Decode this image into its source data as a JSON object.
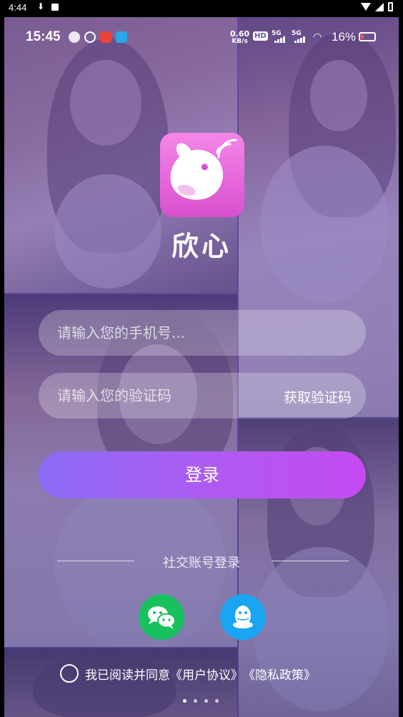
{
  "outer_status": {
    "time": "4:44"
  },
  "inner_status": {
    "time": "15:45",
    "net_speed_value": "0.60",
    "net_speed_unit": "KB/s",
    "hd_label": "HD",
    "sim1": "5G",
    "sim2": "5G",
    "battery_pct": "16%",
    "battery_color": "#ff4d4d"
  },
  "app": {
    "name": "欣心",
    "logo_color_top": "#f487e8",
    "logo_color_bottom": "#d94fcf"
  },
  "login": {
    "phone_placeholder": "请输入您的手机号...",
    "code_placeholder": "请输入您的验证码",
    "get_code_label": "获取验证码",
    "login_label": "登录",
    "social_title": "社交账号登录",
    "social": [
      {
        "name": "wechat",
        "color": "#16c15e"
      },
      {
        "name": "qq",
        "color": "#1aa5f3"
      }
    ],
    "agree_prefix": "我已阅读并同意",
    "user_agreement": "《用户协议》",
    "privacy_policy": "《隐私政策》"
  },
  "carousel": {
    "page_count": 4,
    "active_index": 0
  }
}
